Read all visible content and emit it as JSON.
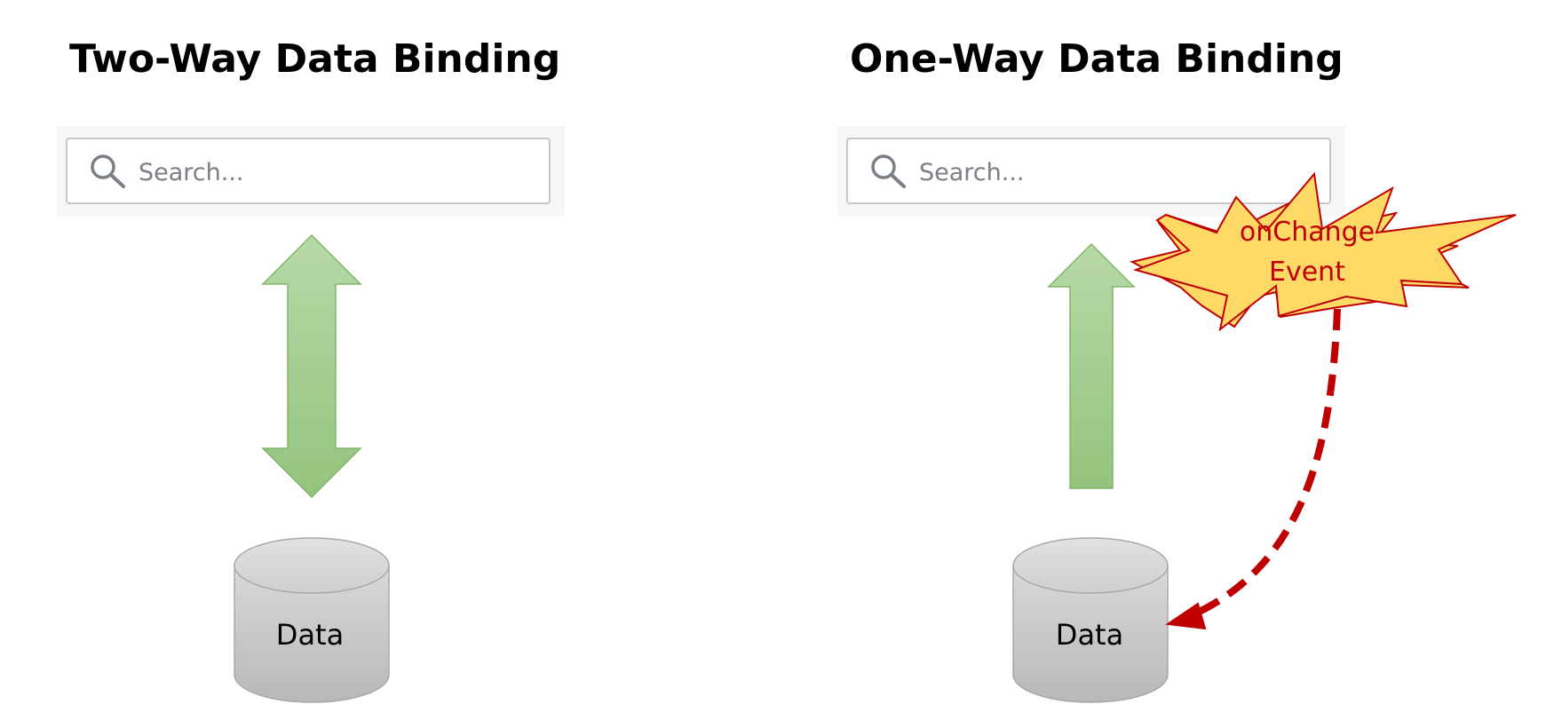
{
  "panels": {
    "left": {
      "title": "Two-Way Data Binding",
      "search_placeholder": "Search...",
      "database_label": "Data"
    },
    "right": {
      "title": "One-Way Data Binding",
      "search_placeholder": "Search...",
      "database_label": "Data",
      "event_label_line1": "onChange",
      "event_label_line2": "Event"
    }
  },
  "icons": {
    "search": "search-icon",
    "database": "database-cylinder",
    "two_way_arrow": "double-headed-arrow",
    "one_way_arrow": "up-arrow",
    "event_burst": "explosion-burst"
  },
  "colors": {
    "arrow_top": "#b7d9a7",
    "arrow_bottom": "#93c47d",
    "arrow_stroke": "#82b567",
    "search_border": "#c8c8c8",
    "search_text": "#7a7f86",
    "search_panel_bg": "#f6f6f7",
    "db_fill_top": "#d9d9d9",
    "db_fill_bottom": "#b8b8b8",
    "db_stroke": "#a8a8a8",
    "burst_fill": "#ffd966",
    "burst_stroke": "#c00000",
    "event_text": "#c00000",
    "dashed_arrow": "#c00000"
  }
}
